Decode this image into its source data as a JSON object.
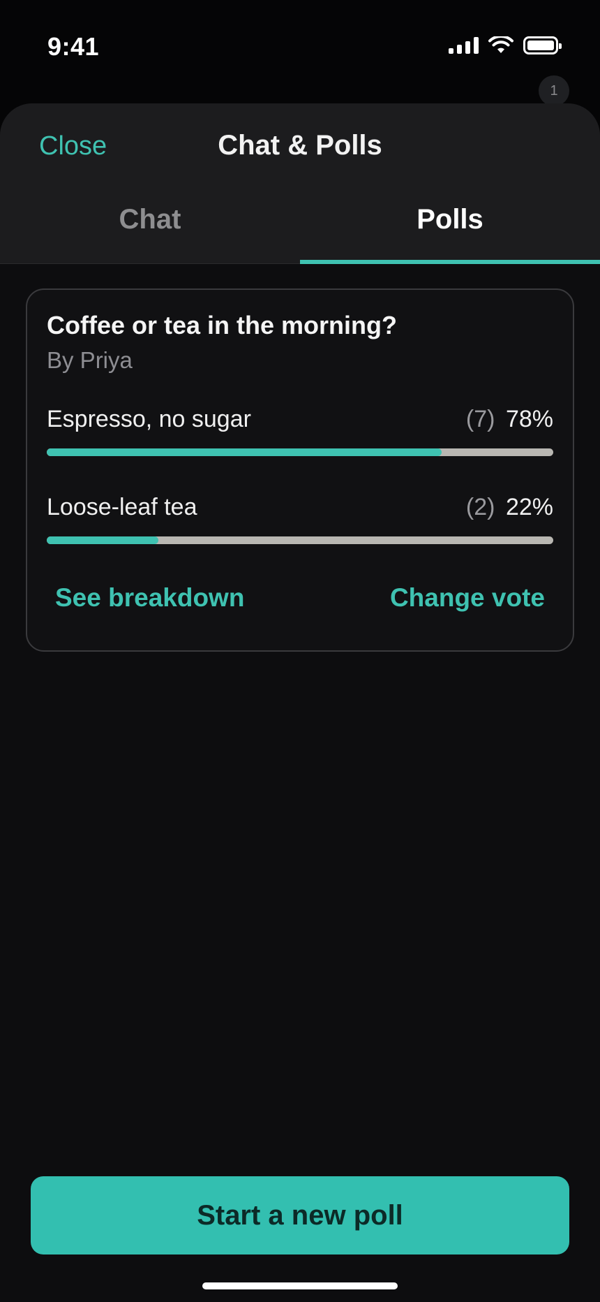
{
  "status_bar": {
    "time": "9:41"
  },
  "notification_badge": "1",
  "sheet": {
    "close_label": "Close",
    "title": "Chat & Polls",
    "tabs": [
      {
        "label": "Chat",
        "active": false
      },
      {
        "label": "Polls",
        "active": true
      }
    ]
  },
  "poll": {
    "question": "Coffee or tea in the morning?",
    "author": "By Priya",
    "options": [
      {
        "label": "Espresso, no sugar",
        "count": "(7)",
        "percent": "78%",
        "fill": 0.78
      },
      {
        "label": "Loose-leaf tea",
        "count": "(2)",
        "percent": "22%",
        "fill": 0.22
      }
    ],
    "actions": {
      "breakdown": "See breakdown",
      "change_vote": "Change vote"
    }
  },
  "footer": {
    "primary_button": "Start a new poll"
  },
  "colors": {
    "accent": "#3fc2b1",
    "background": "#0d0d0f",
    "header": "#1c1c1e",
    "track": "#b9b7b2"
  }
}
